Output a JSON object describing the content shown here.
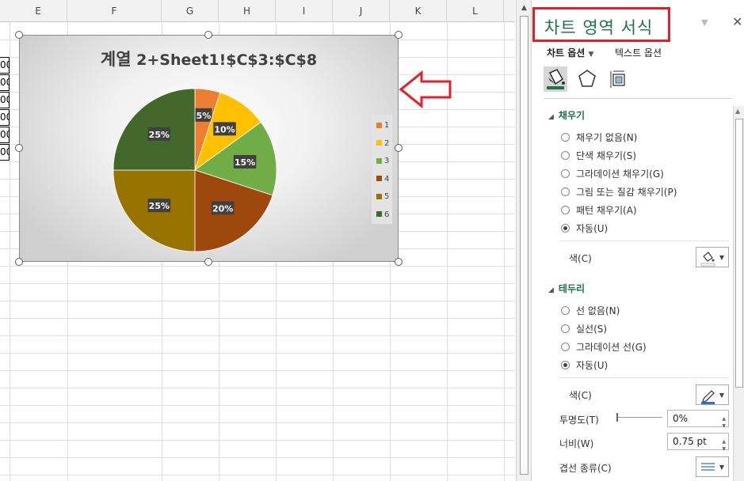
{
  "sheet": {
    "columns": [
      "E",
      "F",
      "G",
      "H",
      "I",
      "J",
      "K",
      "L"
    ],
    "row_fragments": [
      "00",
      "00",
      "00",
      "00",
      "00",
      "00"
    ]
  },
  "chart": {
    "title_prefix": "계열",
    "title_suffix": "2+Sheet1!$C$3:$C$8",
    "legend": [
      {
        "label": "1",
        "color": "#ED7D31"
      },
      {
        "label": "2",
        "color": "#FFC000"
      },
      {
        "label": "3",
        "color": "#70AD47"
      },
      {
        "label": "4",
        "color": "#9E480E"
      },
      {
        "label": "5",
        "color": "#997300"
      },
      {
        "label": "6",
        "color": "#43682B"
      }
    ]
  },
  "chart_data": {
    "type": "pie",
    "title": "계열 2+Sheet1!$C$3:$C$8",
    "categories": [
      "1",
      "2",
      "3",
      "4",
      "5",
      "6"
    ],
    "values": [
      5,
      10,
      15,
      20,
      25,
      25
    ],
    "data_labels": [
      "5%",
      "10%",
      "15%",
      "20%",
      "25%",
      "25%"
    ],
    "colors": [
      "#ED7D31",
      "#FFC000",
      "#70AD47",
      "#9E480E",
      "#997300",
      "#43682B"
    ],
    "legend_position": "right"
  },
  "pane": {
    "title": "차트 영역 서식",
    "tab_chart": "차트 옵션",
    "tab_text": "텍스트 옵션",
    "icons": [
      "fill-bucket-icon",
      "pentagon-icon",
      "size-properties-icon"
    ],
    "fill": {
      "header": "채우기",
      "options": [
        "채우기 없음(N)",
        "단색 채우기(S)",
        "그라데이션 채우기(G)",
        "그림 또는 질감 채우기(P)",
        "패턴 채우기(A)",
        "자동(U)"
      ],
      "selected": "자동(U)",
      "color_label": "색(C)"
    },
    "border": {
      "header": "테두리",
      "options": [
        "선 없음(N)",
        "실선(S)",
        "그라데이션 선(G)",
        "자동(U)"
      ],
      "selected": "자동(U)",
      "color_label": "색(C)",
      "transparency_label": "투명도(T)",
      "transparency_value": "0%",
      "width_label": "너비(W)",
      "width_value": "0.75 pt",
      "compound_label": "겹선 종류(C)"
    }
  }
}
